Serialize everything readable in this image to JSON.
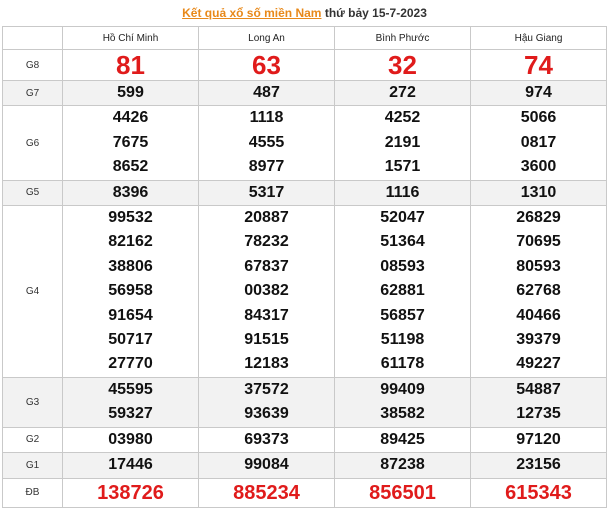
{
  "header": {
    "title_link": "Kết quả xổ số miền Nam",
    "title_rest": " thứ bảy 15-7-2023"
  },
  "provinces": [
    "Hồ Chí Minh",
    "Long An",
    "Bình Phước",
    "Hậu Giang"
  ],
  "prizes": [
    {
      "label": "G8",
      "values": [
        [
          "81"
        ],
        [
          "63"
        ],
        [
          "32"
        ],
        [
          "74"
        ]
      ]
    },
    {
      "label": "G7",
      "values": [
        [
          "599"
        ],
        [
          "487"
        ],
        [
          "272"
        ],
        [
          "974"
        ]
      ]
    },
    {
      "label": "G6",
      "values": [
        [
          "4426",
          "7675",
          "8652"
        ],
        [
          "1118",
          "4555",
          "8977"
        ],
        [
          "4252",
          "2191",
          "1571"
        ],
        [
          "5066",
          "0817",
          "3600"
        ]
      ]
    },
    {
      "label": "G5",
      "values": [
        [
          "8396"
        ],
        [
          "5317"
        ],
        [
          "1116"
        ],
        [
          "1310"
        ]
      ]
    },
    {
      "label": "G4",
      "values": [
        [
          "99532",
          "82162",
          "38806",
          "56958",
          "91654",
          "50717",
          "27770"
        ],
        [
          "20887",
          "78232",
          "67837",
          "00382",
          "84317",
          "91515",
          "12183"
        ],
        [
          "52047",
          "51364",
          "08593",
          "62881",
          "56857",
          "51198",
          "61178"
        ],
        [
          "26829",
          "70695",
          "80593",
          "62768",
          "40466",
          "39379",
          "49227"
        ]
      ]
    },
    {
      "label": "G3",
      "values": [
        [
          "45595",
          "59327"
        ],
        [
          "37572",
          "93639"
        ],
        [
          "99409",
          "38582"
        ],
        [
          "54887",
          "12735"
        ]
      ]
    },
    {
      "label": "G2",
      "values": [
        [
          "03980"
        ],
        [
          "69373"
        ],
        [
          "89425"
        ],
        [
          "97120"
        ]
      ]
    },
    {
      "label": "G1",
      "values": [
        [
          "17446"
        ],
        [
          "99084"
        ],
        [
          "87238"
        ],
        [
          "23156"
        ]
      ]
    },
    {
      "label": "ĐB",
      "values": [
        [
          "138726"
        ],
        [
          "885234"
        ],
        [
          "856501"
        ],
        [
          "615343"
        ]
      ]
    }
  ],
  "colors": {
    "accent": "#e01b1b",
    "title_link": "#e8891a",
    "row_alt": "#f2f2f2",
    "border": "#c9c9c9"
  }
}
